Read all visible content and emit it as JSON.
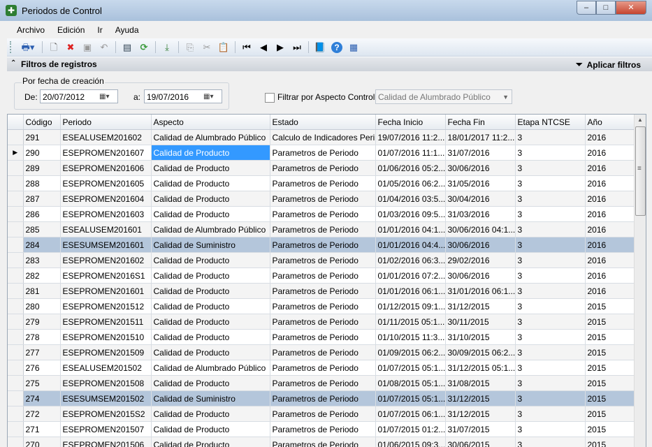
{
  "window": {
    "title": "Periodos de Control"
  },
  "menu": [
    "Archivo",
    "Edición",
    "Ir",
    "Ayuda"
  ],
  "filters": {
    "header": "Filtros de registros",
    "apply_label": "Aplicar filtros",
    "group_title": "Por fecha de creación",
    "de_label": "De:",
    "de_value": "20/07/2012",
    "a_label": "a:",
    "a_value": "19/07/2016",
    "aspecto_checkbox_label": "Filtrar por Aspecto Control:",
    "aspecto_value": "Calidad de Alumbrado Público"
  },
  "grid": {
    "columns": [
      "Código",
      "Periodo",
      "Aspecto",
      "Estado",
      "Fecha Inicio",
      "Fecha Fin",
      "Etapa NTCSE",
      "Año"
    ],
    "rows": [
      [
        "291",
        "ESEALUSEM201602",
        "Calidad de Alumbrado Público",
        "Calculo de Indicadores Peri...",
        "19/07/2016 11:2...",
        "18/01/2017 11:2...",
        "3",
        "2016"
      ],
      [
        "290",
        "ESEPROMEN201607",
        "Calidad de Producto",
        "Parametros de Periodo",
        "01/07/2016 11:1...",
        "31/07/2016",
        "3",
        "2016"
      ],
      [
        "289",
        "ESEPROMEN201606",
        "Calidad de Producto",
        "Parametros de Periodo",
        "01/06/2016 05:2...",
        "30/06/2016",
        "3",
        "2016"
      ],
      [
        "288",
        "ESEPROMEN201605",
        "Calidad de Producto",
        "Parametros de Periodo",
        "01/05/2016 06:2...",
        "31/05/2016",
        "3",
        "2016"
      ],
      [
        "287",
        "ESEPROMEN201604",
        "Calidad de Producto",
        "Parametros de Periodo",
        "01/04/2016 03:5...",
        "30/04/2016",
        "3",
        "2016"
      ],
      [
        "286",
        "ESEPROMEN201603",
        "Calidad de Producto",
        "Parametros de Periodo",
        "01/03/2016 09:5...",
        "31/03/2016",
        "3",
        "2016"
      ],
      [
        "285",
        "ESEALUSEM201601",
        "Calidad de Alumbrado Público",
        "Parametros de Periodo",
        "01/01/2016 04:1...",
        "30/06/2016 04:1...",
        "3",
        "2016"
      ],
      [
        "284",
        "ESESUMSEM201601",
        "Calidad de Suministro",
        "Parametros de Periodo",
        "01/01/2016 04:4...",
        "30/06/2016",
        "3",
        "2016"
      ],
      [
        "283",
        "ESEPROMEN201602",
        "Calidad de Producto",
        "Parametros de Periodo",
        "01/02/2016 06:3...",
        "29/02/2016",
        "3",
        "2016"
      ],
      [
        "282",
        "ESEPROMEN2016S1",
        "Calidad de Producto",
        "Parametros de Periodo",
        "01/01/2016 07:2...",
        "30/06/2016",
        "3",
        "2016"
      ],
      [
        "281",
        "ESEPROMEN201601",
        "Calidad de Producto",
        "Parametros de Periodo",
        "01/01/2016 06:1...",
        "31/01/2016 06:1...",
        "3",
        "2016"
      ],
      [
        "280",
        "ESEPROMEN201512",
        "Calidad de Producto",
        "Parametros de Periodo",
        "01/12/2015 09:1...",
        "31/12/2015",
        "3",
        "2015"
      ],
      [
        "279",
        "ESEPROMEN201511",
        "Calidad de Producto",
        "Parametros de Periodo",
        "01/11/2015 05:1...",
        "30/11/2015",
        "3",
        "2015"
      ],
      [
        "278",
        "ESEPROMEN201510",
        "Calidad de Producto",
        "Parametros de Periodo",
        "01/10/2015 11:3...",
        "31/10/2015",
        "3",
        "2015"
      ],
      [
        "277",
        "ESEPROMEN201509",
        "Calidad de Producto",
        "Parametros de Periodo",
        "01/09/2015 06:2...",
        "30/09/2015 06:2...",
        "3",
        "2015"
      ],
      [
        "276",
        "ESEALUSEM201502",
        "Calidad de Alumbrado Público",
        "Parametros de Periodo",
        "01/07/2015 05:1...",
        "31/12/2015 05:1...",
        "3",
        "2015"
      ],
      [
        "275",
        "ESEPROMEN201508",
        "Calidad de Producto",
        "Parametros de Periodo",
        "01/08/2015 05:1...",
        "31/08/2015",
        "3",
        "2015"
      ],
      [
        "274",
        "ESESUMSEM201502",
        "Calidad de Suministro",
        "Parametros de Periodo",
        "01/07/2015 05:1...",
        "31/12/2015",
        "3",
        "2015"
      ],
      [
        "272",
        "ESEPROMEN2015S2",
        "Calidad de Producto",
        "Parametros de Periodo",
        "01/07/2015 06:1...",
        "31/12/2015",
        "3",
        "2015"
      ],
      [
        "271",
        "ESEPROMEN201507",
        "Calidad de Producto",
        "Parametros de Periodo",
        "01/07/2015 01:2...",
        "31/07/2015",
        "3",
        "2015"
      ],
      [
        "270",
        "ESEPROMEN201506",
        "Calidad de Producto",
        "Parametros de Periodo",
        "01/06/2015 09:3...",
        "30/06/2015",
        "3",
        "2015"
      ]
    ],
    "highlighted_codes": [
      "284",
      "274"
    ],
    "current_row_code": "290"
  },
  "colors": {
    "selection": "#3399ff",
    "highlight_row": "#b4c6db"
  }
}
